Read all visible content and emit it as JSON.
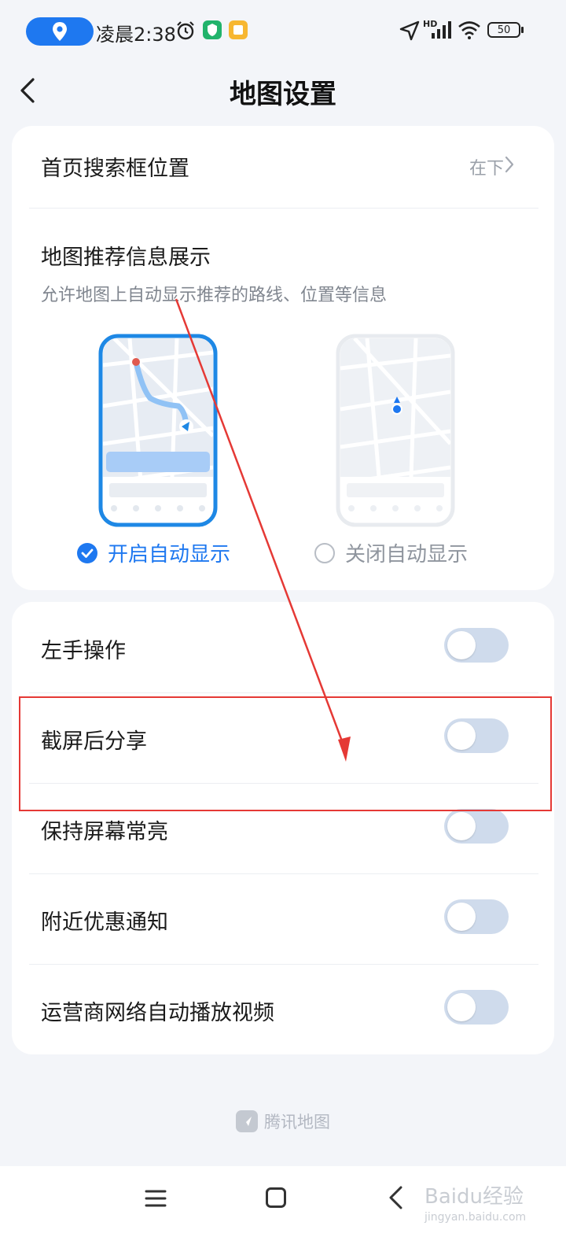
{
  "status_bar": {
    "time": "凌晨2:38",
    "battery": "50",
    "network": "HD"
  },
  "header": {
    "title": "地图设置"
  },
  "search_position": {
    "label": "首页搜索框位置",
    "value": "在下"
  },
  "recommend": {
    "title": "地图推荐信息展示",
    "description": "允许地图上自动显示推荐的路线、位置等信息",
    "options": [
      {
        "label": "开启自动显示",
        "selected": true
      },
      {
        "label": "关闭自动显示",
        "selected": false
      }
    ]
  },
  "toggles": [
    {
      "label": "左手操作",
      "on": false
    },
    {
      "label": "截屏后分享",
      "on": false
    },
    {
      "label": "保持屏幕常亮",
      "on": false
    },
    {
      "label": "附近优惠通知",
      "on": false
    },
    {
      "label": "运营商网络自动播放视频",
      "on": false
    }
  ],
  "footer": {
    "brand": "腾讯地图"
  },
  "watermark": {
    "text": "Baidu经验",
    "sub": "jingyan.baidu.com"
  },
  "colors": {
    "accent": "#1e78f0",
    "background": "#f3f5f9",
    "toggle_off": "#cfdbec",
    "annotation": "#e53935"
  }
}
